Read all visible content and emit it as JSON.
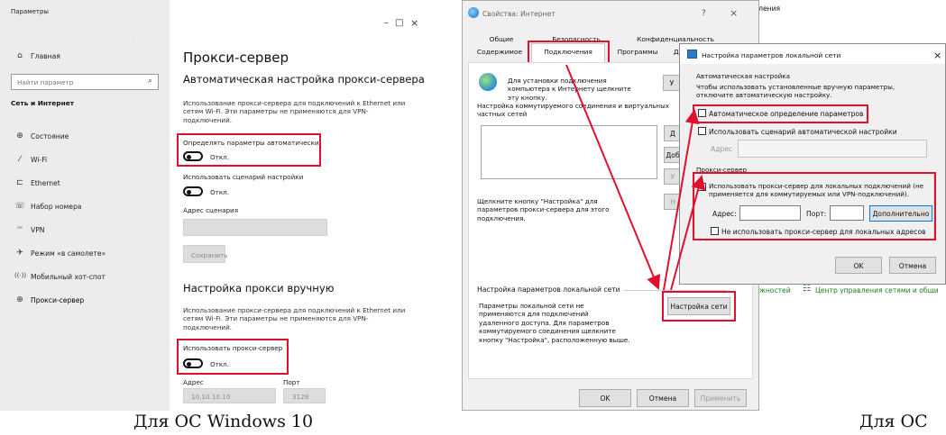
{
  "win10": {
    "title": "Параметры",
    "window_controls": {
      "minimize": "–",
      "maximize": "□",
      "close": "×"
    },
    "sidebar": {
      "home": "Главная",
      "search_placeholder": "Найти параметр",
      "section": "Сеть и Интернет",
      "items": [
        {
          "label": "Состояние",
          "icon": "globe-icon"
        },
        {
          "label": "Wi-Fi",
          "icon": "wifi-icon"
        },
        {
          "label": "Ethernet",
          "icon": "ethernet-icon"
        },
        {
          "label": "Набор номера",
          "icon": "dialup-icon"
        },
        {
          "label": "VPN",
          "icon": "vpn-icon"
        },
        {
          "label": "Режим «в самолете»",
          "icon": "airplane-icon"
        },
        {
          "label": "Мобильный хот-спот",
          "icon": "hotspot-icon"
        },
        {
          "label": "Прокси-сервер",
          "icon": "proxy-icon"
        }
      ]
    },
    "page_title": "Прокси-сервер",
    "auto": {
      "heading": "Автоматическая настройка прокси-сервера",
      "description": "Использование прокси-сервера для подключений к Ethernet или сетям Wi-Fi. Эти параметры не применяются для VPN-подключений.",
      "detect_label": "Определять параметры автоматически",
      "detect_state": "Откл.",
      "script_label": "Использовать сценарий настройки",
      "script_state": "Откл.",
      "address_label": "Адрес сценария",
      "save_label": "Сохранить"
    },
    "manual": {
      "heading": "Настройка прокси вручную",
      "description": "Использование прокси-сервера для подключений к Ethernet или сетям Wi-Fi. Эти параметры не применяются для VPN-подключений.",
      "use_label": "Использовать прокси-сервер",
      "use_state": "Откл.",
      "address_label": "Адрес",
      "address_value": "10.10.10.10",
      "port_label": "Порт",
      "port_value": "3128"
    }
  },
  "inet": {
    "title": "Свойства: Интернет",
    "help": "?",
    "close": "×",
    "tabs_row1": [
      "Общие",
      "Безопасность",
      "Конфиденциальность"
    ],
    "tabs_row2": [
      "Содержимое",
      "Подключения",
      "Программы",
      "До"
    ],
    "setup_text": "Для установки подключения компьютера к Интернету щелкните эту кнопку.",
    "setup_button": "У",
    "dialup_label": "Настройка коммутируемого соединения и виртуальных частных сетей",
    "side_buttons": [
      "Д",
      "Доб",
      "У",
      "Н"
    ],
    "proxy_hint": "Щелкните кнопку \"Настройка\" для параметров прокси-сервера для этого подключения.",
    "lan_label": "Настройка параметров локальной сети",
    "lan_text": "Параметры локальной сети не применяются для подключений удаленного доступа. Для параметров коммутируемого соединения щелкните кнопку \"Настройка\", расположенную выше.",
    "lan_button": "Настройка сети",
    "ok": "OK",
    "cancel": "Отмена",
    "apply": "Применить"
  },
  "behind": {
    "title_fragment": "авления",
    "link_left": "жностей",
    "link_right": "Центр управления сетями и общи"
  },
  "lan": {
    "title": "Настройка параметров локальной сети",
    "close": "×",
    "auto_group": "Автоматическая настройка",
    "auto_text": "Чтобы использовать установленные вручную параметры, отключите автоматическую настройку.",
    "auto_detect": "Автоматическое определение параметров",
    "auto_detect_checked": false,
    "use_script": "Использовать сценарий автоматической настройки",
    "use_script_checked": false,
    "address_label": "Адрес",
    "proxy_group": "Прокси-сервер",
    "use_proxy": "Использовать прокси-сервер для локальных подключений (не применяется для коммутируемых или VPN-подключений).",
    "use_proxy_checked": false,
    "proxy_address_label": "Адрес:",
    "proxy_port_label": "Порт:",
    "advanced": "Дополнительно",
    "bypass": "Не использовать прокси-сервер для локальных адресов",
    "bypass_checked": false,
    "ok": "OK",
    "cancel": "Отмена"
  },
  "captions": {
    "left": "Для ОС Windows 10",
    "right": "Для ОС"
  },
  "colors": {
    "highlight": "#e0102e",
    "settings_sidebar": "#ececec",
    "dialog_bg": "#f0f0f0",
    "button_accent": "#0078d7",
    "link_green": "#1a7f1a"
  }
}
